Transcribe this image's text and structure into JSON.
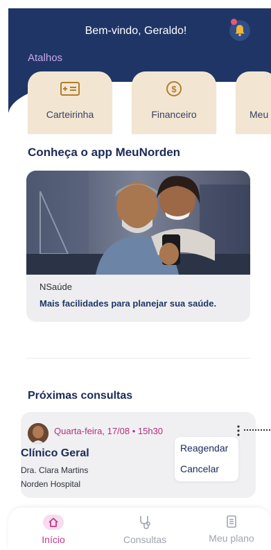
{
  "header": {
    "welcome": "Bem-vindo, Geraldo!",
    "shortcuts_title": "Atalhos",
    "bell_icon": "bell-icon",
    "badge_color": "#e4587c",
    "background_color": "#1f3566"
  },
  "shortcuts": [
    {
      "label": "Carteirinha",
      "icon": "id-card-icon"
    },
    {
      "label": "Financeiro",
      "icon": "dollar-coin-icon"
    },
    {
      "label": "Meu",
      "icon": "more-shortcut-icon"
    }
  ],
  "promo": {
    "title": "Conheça o app MeuNorden",
    "tag": "NSaúde",
    "text": "Mais facilidades para planejar sua saúde."
  },
  "appointments": {
    "title": "Próximas consultas",
    "item": {
      "date": "Quarta-feira, 17/08 • 15h30",
      "specialty": "Clínico Geral",
      "doctor": "Dra. Clara Martins",
      "location": "Norden Hospital"
    },
    "menu": {
      "reschedule": "Reagendar",
      "cancel": "Cancelar"
    }
  },
  "bottom_nav": {
    "home": "Início",
    "consultations": "Consultas",
    "plan": "Meu plano",
    "active_color": "#c23a86"
  }
}
